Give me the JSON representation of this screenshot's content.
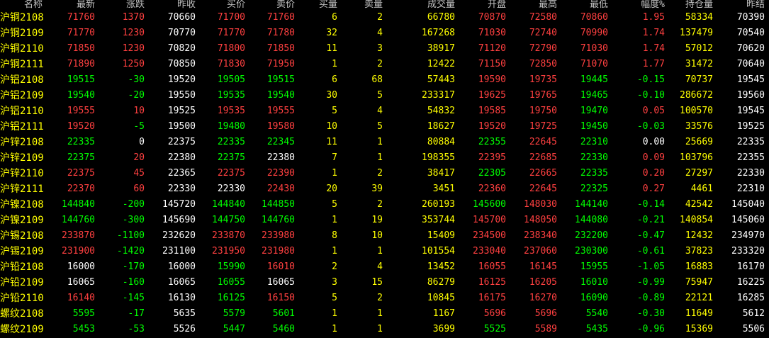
{
  "colors": {
    "up": "#ff4040",
    "down": "#00ff00",
    "flat": "#ffffff",
    "volume": "#ffff00",
    "header": "#c0c0c0",
    "background": "#000000"
  },
  "headers": [
    "名称",
    "最新",
    "涨跌",
    "昨收",
    "买价",
    "卖价",
    "买量",
    "卖量",
    "成交量",
    "开盘",
    "最高",
    "最低",
    "幅度%",
    "持仓量",
    "昨结"
  ],
  "rows": [
    {
      "cells": [
        "沪铜2108",
        "71760",
        "1370",
        "70660",
        "71700",
        "71760",
        "6",
        "2",
        "66780",
        "70870",
        "72580",
        "70860",
        "1.95",
        "58334",
        "70390"
      ]
    },
    {
      "cells": [
        "沪铜2109",
        "71770",
        "1230",
        "70770",
        "71770",
        "71780",
        "32",
        "4",
        "167268",
        "71030",
        "72740",
        "70990",
        "1.74",
        "137479",
        "70540"
      ]
    },
    {
      "cells": [
        "沪铜2110",
        "71850",
        "1230",
        "70820",
        "71800",
        "71850",
        "11",
        "3",
        "38917",
        "71120",
        "72790",
        "71030",
        "1.74",
        "57012",
        "70620"
      ]
    },
    {
      "cells": [
        "沪铜2111",
        "71890",
        "1250",
        "70850",
        "71830",
        "71950",
        "1",
        "2",
        "12422",
        "71150",
        "72850",
        "71070",
        "1.77",
        "31472",
        "70640"
      ]
    },
    {
      "cells": [
        "沪铝2108",
        "19515",
        "-30",
        "19520",
        "19505",
        "19515",
        "6",
        "68",
        "57443",
        "19590",
        "19735",
        "19445",
        "-0.15",
        "70737",
        "19545"
      ]
    },
    {
      "cells": [
        "沪铝2109",
        "19540",
        "-20",
        "19550",
        "19535",
        "19540",
        "30",
        "5",
        "233317",
        "19625",
        "19765",
        "19465",
        "-0.10",
        "286672",
        "19560"
      ]
    },
    {
      "cells": [
        "沪铝2110",
        "19555",
        "10",
        "19525",
        "19535",
        "19555",
        "5",
        "4",
        "54832",
        "19585",
        "19750",
        "19470",
        "0.05",
        "100570",
        "19545"
      ]
    },
    {
      "cells": [
        "沪铝2111",
        "19520",
        "-5",
        "19500",
        "19480",
        "19580",
        "10",
        "5",
        "18627",
        "19520",
        "19725",
        "19450",
        "-0.03",
        "33576",
        "19525"
      ]
    },
    {
      "cells": [
        "沪锌2108",
        "22335",
        "0",
        "22375",
        "22335",
        "22345",
        "11",
        "1",
        "80884",
        "22355",
        "22645",
        "22310",
        "0.00",
        "25669",
        "22335"
      ]
    },
    {
      "cells": [
        "沪锌2109",
        "22375",
        "20",
        "22380",
        "22375",
        "22380",
        "7",
        "1",
        "198355",
        "22395",
        "22685",
        "22330",
        "0.09",
        "103796",
        "22355"
      ]
    },
    {
      "cells": [
        "沪锌2110",
        "22375",
        "45",
        "22365",
        "22375",
        "22390",
        "1",
        "2",
        "38417",
        "22305",
        "22665",
        "22335",
        "0.20",
        "27297",
        "22330"
      ]
    },
    {
      "cells": [
        "沪锌2111",
        "22370",
        "60",
        "22330",
        "22330",
        "22430",
        "20",
        "39",
        "3451",
        "22360",
        "22645",
        "22325",
        "0.27",
        "4461",
        "22310"
      ]
    },
    {
      "cells": [
        "沪镍2108",
        "144840",
        "-200",
        "145720",
        "144840",
        "144850",
        "5",
        "2",
        "260193",
        "145600",
        "148030",
        "144140",
        "-0.14",
        "42542",
        "145040"
      ]
    },
    {
      "cells": [
        "沪镍2109",
        "144760",
        "-300",
        "145690",
        "144750",
        "144760",
        "1",
        "19",
        "353744",
        "145700",
        "148050",
        "144080",
        "-0.21",
        "140854",
        "145060"
      ]
    },
    {
      "cells": [
        "沪锡2108",
        "233870",
        "-1100",
        "232620",
        "233870",
        "233980",
        "8",
        "10",
        "15409",
        "234500",
        "238340",
        "232200",
        "-0.47",
        "12432",
        "234970"
      ]
    },
    {
      "cells": [
        "沪锡2109",
        "231900",
        "-1420",
        "231100",
        "231950",
        "231980",
        "1",
        "1",
        "101554",
        "233040",
        "237060",
        "230300",
        "-0.61",
        "37823",
        "233320"
      ]
    },
    {
      "cells": [
        "沪铅2108",
        "16000",
        "-170",
        "16000",
        "15990",
        "16010",
        "2",
        "4",
        "13452",
        "16055",
        "16145",
        "15955",
        "-1.05",
        "16883",
        "16170"
      ]
    },
    {
      "cells": [
        "沪铅2109",
        "16065",
        "-160",
        "16065",
        "16055",
        "16065",
        "3",
        "15",
        "86279",
        "16125",
        "16205",
        "16010",
        "-0.99",
        "75947",
        "16225"
      ]
    },
    {
      "cells": [
        "沪铅2110",
        "16140",
        "-145",
        "16130",
        "16125",
        "16150",
        "5",
        "2",
        "10845",
        "16175",
        "16270",
        "16090",
        "-0.89",
        "22121",
        "16285"
      ]
    },
    {
      "cells": [
        "螺纹2108",
        "5595",
        "-17",
        "5635",
        "5579",
        "5601",
        "1",
        "1",
        "1167",
        "5696",
        "5696",
        "5540",
        "-0.30",
        "11649",
        "5612"
      ]
    },
    {
      "cells": [
        "螺纹2109",
        "5453",
        "-53",
        "5526",
        "5447",
        "5460",
        "1",
        "1",
        "3699",
        "5525",
        "5589",
        "5435",
        "-0.96",
        "15369",
        "5506"
      ]
    }
  ]
}
